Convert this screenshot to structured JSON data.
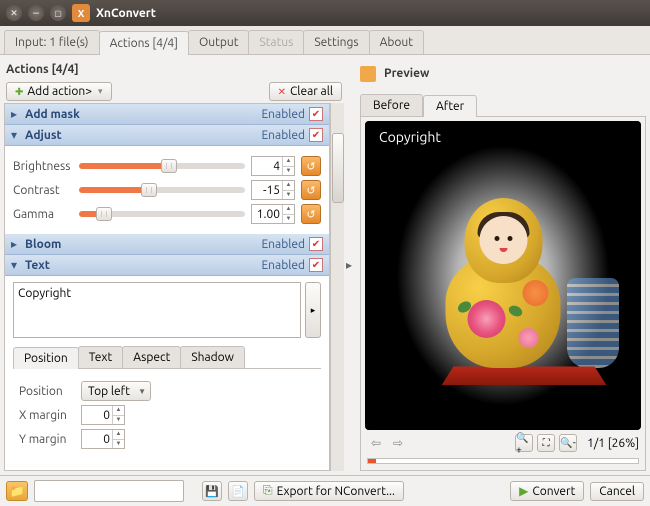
{
  "window": {
    "title": "XnConvert"
  },
  "main_tabs": {
    "input": "Input: 1 file(s)",
    "actions": "Actions [4/4]",
    "output": "Output",
    "status": "Status",
    "settings": "Settings",
    "about": "About"
  },
  "actions_panel": {
    "heading": "Actions [4/4]",
    "add_action_btn": "Add action>",
    "clear_all_btn": "Clear all",
    "items": [
      {
        "name": "Add mask",
        "enabled_label": "Enabled",
        "expanded": false
      },
      {
        "name": "Adjust",
        "enabled_label": "Enabled",
        "expanded": true,
        "params": {
          "brightness": {
            "label": "Brightness",
            "value": "4",
            "slider_pct": 54
          },
          "contrast": {
            "label": "Contrast",
            "value": "-15",
            "slider_pct": 42
          },
          "gamma": {
            "label": "Gamma",
            "value": "1.00",
            "slider_pct": 15
          }
        }
      },
      {
        "name": "Bloom",
        "enabled_label": "Enabled",
        "expanded": false
      },
      {
        "name": "Text",
        "enabled_label": "Enabled",
        "expanded": true,
        "text_value": "Copyright",
        "subtabs": {
          "position": "Position",
          "text": "Text",
          "aspect": "Aspect",
          "shadow": "Shadow"
        },
        "position": {
          "label": "Position",
          "value": "Top left",
          "xmargin_label": "X margin",
          "xmargin": "0",
          "ymargin_label": "Y margin",
          "ymargin": "0"
        }
      }
    ]
  },
  "preview": {
    "heading": "Preview",
    "tabs": {
      "before": "Before",
      "after": "After"
    },
    "watermark_text": "Copyright",
    "nav_info": "1/1 [26%]"
  },
  "footer": {
    "export_btn": "Export for NConvert...",
    "convert_btn": "Convert",
    "cancel_btn": "Cancel"
  }
}
